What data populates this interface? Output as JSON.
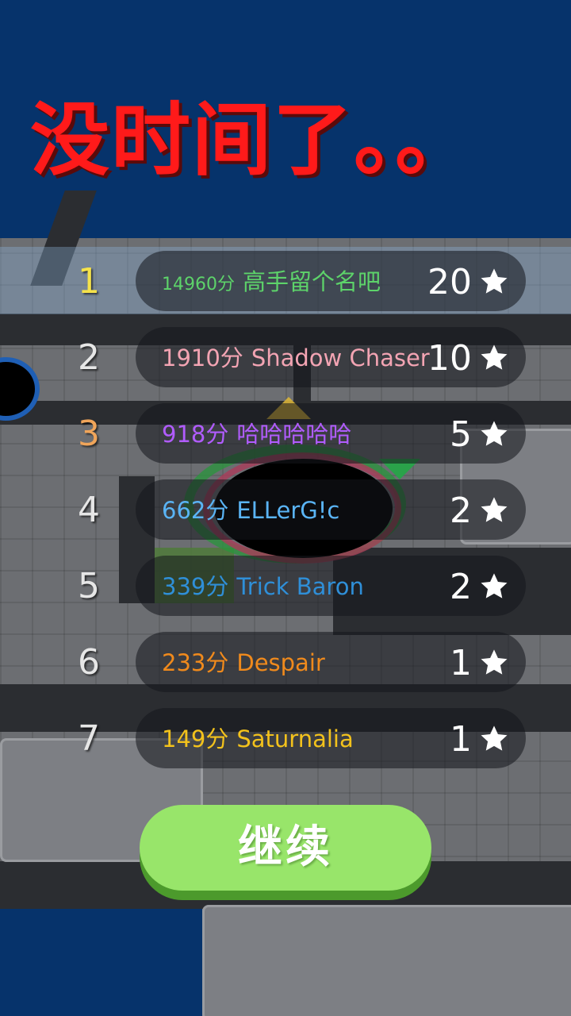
{
  "title": "没时间了。。",
  "colors": {
    "background_water": "#06336b",
    "title": "#ff1a1a",
    "button": "#98e56a",
    "highlight_row": "#8cb4dc"
  },
  "leaderboard": [
    {
      "rank": "1",
      "score": "14960分",
      "name": "高手留个名吧",
      "stars": "20",
      "rank_color": "#f5e24a",
      "name_color": "#5dd36a",
      "highlighted": true
    },
    {
      "rank": "2",
      "score": "1910分",
      "name": "Shadow Chaser",
      "stars": "10",
      "rank_color": "#e6e6e6",
      "name_color": "#f3a4b3",
      "highlighted": false
    },
    {
      "rank": "3",
      "score": "918分",
      "name": "哈哈哈哈哈",
      "stars": "5",
      "rank_color": "#f0a55a",
      "name_color": "#b15cff",
      "highlighted": false
    },
    {
      "rank": "4",
      "score": "662分",
      "name": "ELLerG!c",
      "stars": "2",
      "rank_color": "#e6e6e6",
      "name_color": "#5ab4f5",
      "highlighted": false
    },
    {
      "rank": "5",
      "score": "339分",
      "name": "Trick Baron",
      "stars": "2",
      "rank_color": "#e6e6e6",
      "name_color": "#2f8fd8",
      "highlighted": false
    },
    {
      "rank": "6",
      "score": "233分",
      "name": "Despair",
      "stars": "1",
      "rank_color": "#e6e6e6",
      "name_color": "#f08a1c",
      "highlighted": false
    },
    {
      "rank": "7",
      "score": "149分",
      "name": "Saturnalia",
      "stars": "1",
      "rank_color": "#e6e6e6",
      "name_color": "#f3c21c",
      "highlighted": false
    }
  ],
  "star_icon": "star-icon",
  "continue_button": {
    "label": "继续"
  }
}
